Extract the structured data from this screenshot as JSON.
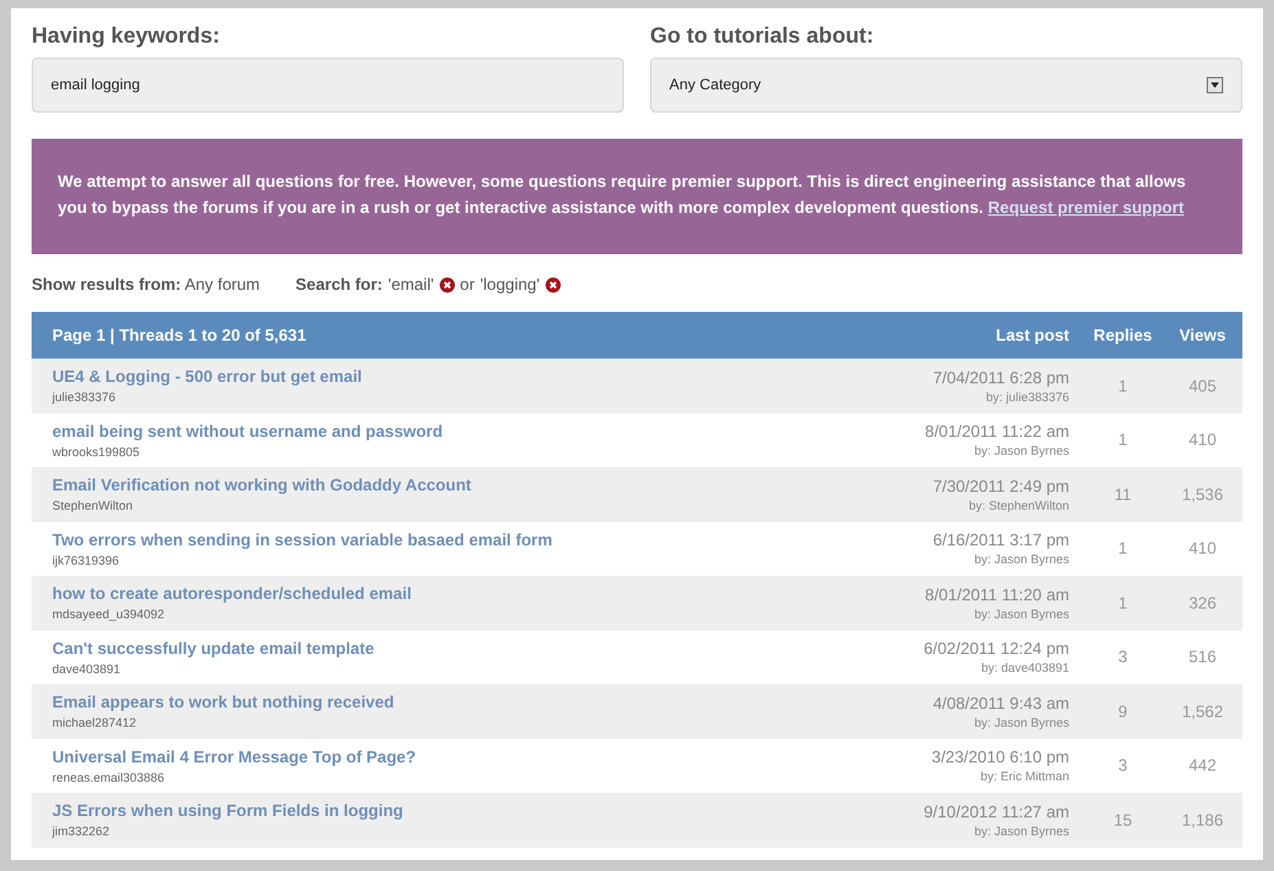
{
  "keywords": {
    "label": "Having keywords:",
    "value": "email logging"
  },
  "category": {
    "label": "Go to tutorials about:",
    "value": "Any Category"
  },
  "notice": {
    "text": "We attempt to answer all questions for free. However, some questions require premier support. This is direct engineering assistance that allows you to bypass the forums if you are in a rush or get interactive assistance with more complex development questions.",
    "link": "Request premier support"
  },
  "filters": {
    "forum_label": "Show results from:",
    "forum_value": "Any forum",
    "search_label": "Search for:",
    "terms": [
      "'email'",
      "'logging'"
    ],
    "joiner": "or"
  },
  "table": {
    "columns": [
      "Page 1 | Threads 1 to 20 of 5,631",
      "Last post",
      "Replies",
      "Views"
    ],
    "rows": [
      {
        "title": "UE4 & Logging - 500 error but get email",
        "author": "julie383376",
        "last_post": "7/04/2011 6:28 pm",
        "last_by": "by: julie383376",
        "replies": "1",
        "views": "405"
      },
      {
        "title": "email being sent without username and password",
        "author": "wbrooks199805",
        "last_post": "8/01/2011 11:22 am",
        "last_by": "by: Jason Byrnes",
        "replies": "1",
        "views": "410"
      },
      {
        "title": "Email Verification not working with Godaddy Account",
        "author": "StephenWilton",
        "last_post": "7/30/2011 2:49 pm",
        "last_by": "by: StephenWilton",
        "replies": "11",
        "views": "1,536"
      },
      {
        "title": "Two errors when sending in session variable basaed email form",
        "author": "ijk76319396",
        "last_post": "6/16/2011 3:17 pm",
        "last_by": "by: Jason Byrnes",
        "replies": "1",
        "views": "410"
      },
      {
        "title": "how to create autoresponder/scheduled email",
        "author": "mdsayeed_u394092",
        "last_post": "8/01/2011 11:20 am",
        "last_by": "by: Jason Byrnes",
        "replies": "1",
        "views": "326"
      },
      {
        "title": "Can't successfully update email template",
        "author": "dave403891",
        "last_post": "6/02/2011 12:24 pm",
        "last_by": "by: dave403891",
        "replies": "3",
        "views": "516"
      },
      {
        "title": "Email appears to work but nothing received",
        "author": "michael287412",
        "last_post": "4/08/2011 9:43 am",
        "last_by": "by: Jason Byrnes",
        "replies": "9",
        "views": "1,562"
      },
      {
        "title": "Universal Email 4 Error Message Top of Page?",
        "author": "reneas.email303886",
        "last_post": "3/23/2010 6:10 pm",
        "last_by": "by: Eric Mittman",
        "replies": "3",
        "views": "442"
      },
      {
        "title": "JS Errors when using Form Fields in logging",
        "author": "jim332262",
        "last_post": "9/10/2012 11:27 am",
        "last_by": "by: Jason Byrnes",
        "replies": "15",
        "views": "1,186"
      }
    ]
  }
}
